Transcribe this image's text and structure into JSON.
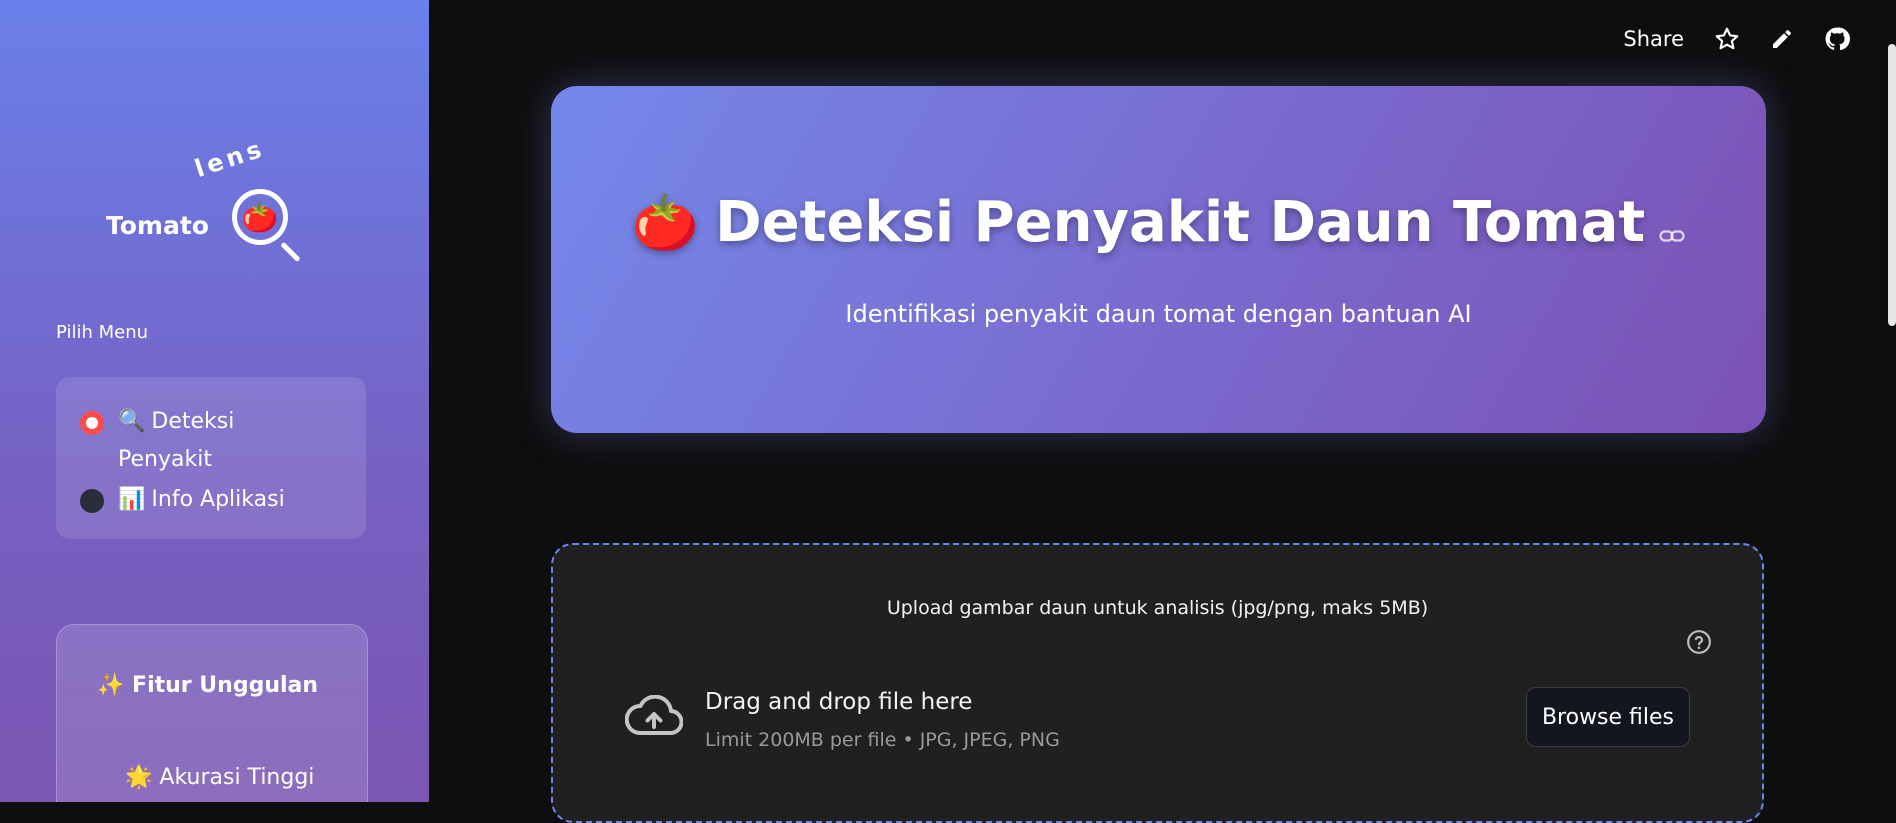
{
  "sidebar": {
    "logo": {
      "word": "Tomato",
      "lens": "lens",
      "emoji": "🍅"
    },
    "menu_title": "Pilih Menu",
    "menu_items": [
      {
        "icon": "🔍",
        "label": "Deteksi Penyakit",
        "selected": true
      },
      {
        "icon": "📊",
        "label": "Info Aplikasi",
        "selected": false
      }
    ],
    "features": {
      "title": "✨ Fitur Unggulan",
      "items": [
        {
          "icon": "🌟",
          "label": "Akurasi Tinggi"
        }
      ]
    }
  },
  "toolbar": {
    "share_label": "Share",
    "icons": [
      "star-icon",
      "pencil-icon",
      "github-icon"
    ]
  },
  "hero": {
    "icon": "🍅",
    "title": "Deteksi Penyakit Daun Tomat",
    "subtitle": "Identifikasi penyakit daun tomat dengan bantuan AI"
  },
  "uploader": {
    "label": "Upload gambar daun untuk analisis (jpg/png, maks 5MB)",
    "drop_title": "Drag and drop file here",
    "limit": "Limit 200MB per file • JPG, JPEG, PNG",
    "browse_label": "Browse files"
  },
  "colors": {
    "accent": "#ff4b4b",
    "dashed_border": "#6e85ee",
    "background": "#0e0e0e"
  }
}
